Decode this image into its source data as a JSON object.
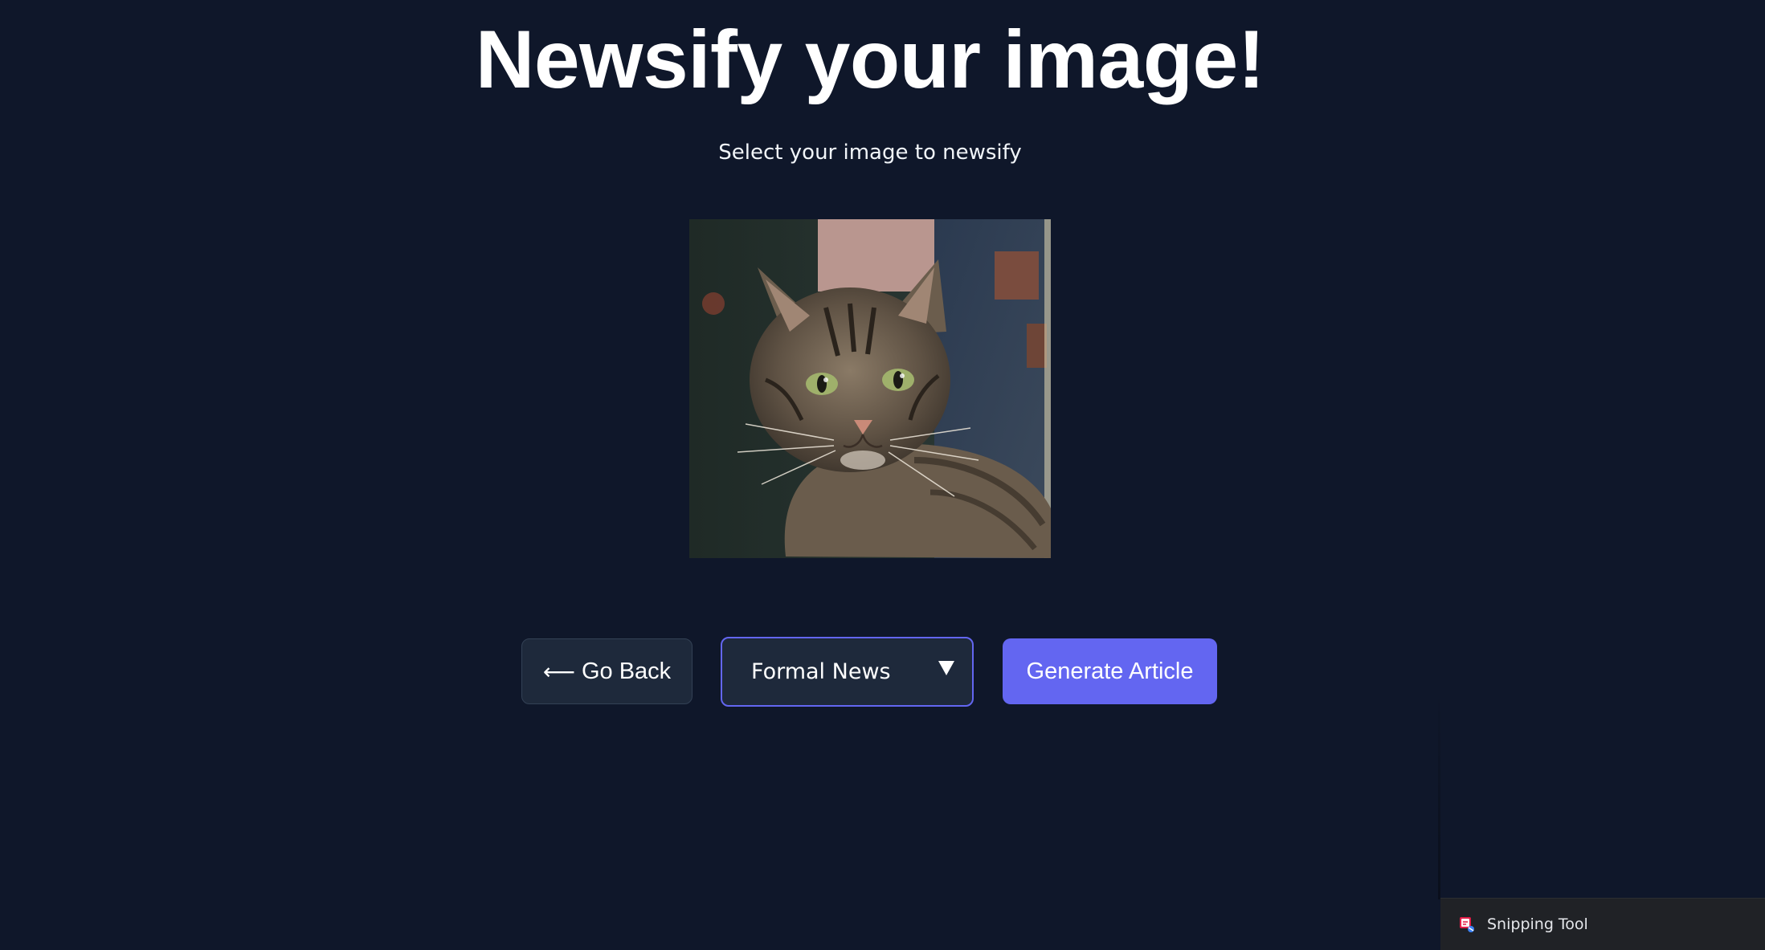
{
  "header": {
    "title": "Newsify your image!",
    "subtitle": "Select your image to newsify"
  },
  "preview": {
    "content": "tabby-cat-photo"
  },
  "controls": {
    "back_arrow": "⟵",
    "back_label": "Go Back",
    "style_select": {
      "selected": "Formal News"
    },
    "generate_label": "Generate Article"
  },
  "taskbar": {
    "app_label": "Snipping Tool",
    "app_icon": "snipping-tool-icon"
  },
  "colors": {
    "background": "#0f172a",
    "accent": "#6366f1",
    "button_dark": "#1e293b"
  }
}
